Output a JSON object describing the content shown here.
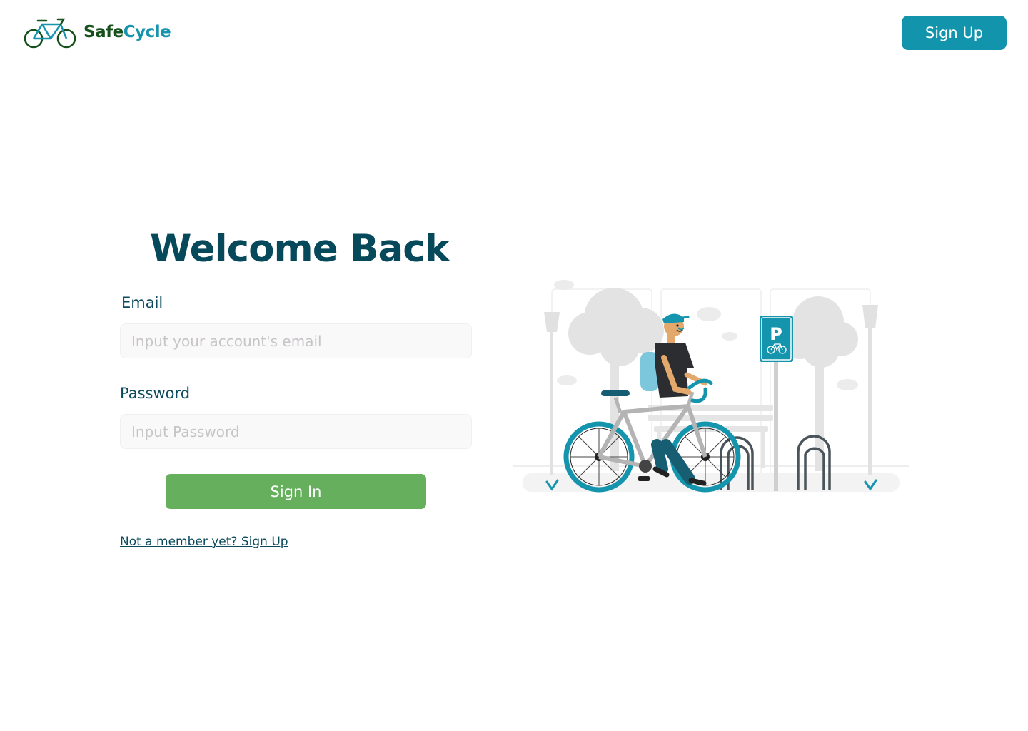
{
  "header": {
    "brand_part1": "Safe",
    "brand_part2": "Cycle",
    "signup_label": "Sign Up"
  },
  "login": {
    "title": "Welcome Back",
    "email_label": "Email",
    "email_placeholder": "Input your account's email",
    "password_label": "Password",
    "password_placeholder": "Input Password",
    "signin_label": "Sign In",
    "member_link": "Not a member yet? Sign Up"
  },
  "illustration": {
    "parking_sign_letter": "P"
  },
  "colors": {
    "primary_teal": "#1394ad",
    "title_dark": "#06495b",
    "signin_green": "#66b05d",
    "brand_green": "#16511c"
  }
}
